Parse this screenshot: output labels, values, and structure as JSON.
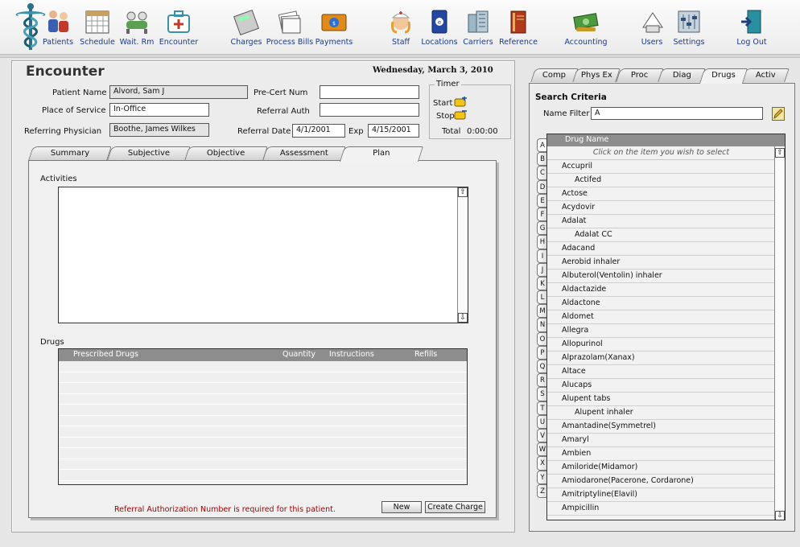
{
  "toolbar": {
    "items": [
      {
        "label": "Patients",
        "icon": "patients-icon"
      },
      {
        "label": "Schedule",
        "icon": "schedule-icon"
      },
      {
        "label": "Wait. Rm",
        "icon": "waiting-room-icon"
      },
      {
        "label": "Encounter",
        "icon": "encounter-icon"
      },
      {
        "label": "Charges",
        "icon": "calculator-icon"
      },
      {
        "label": "Process Bills",
        "icon": "bills-icon"
      },
      {
        "label": "Payments",
        "icon": "payment-card-icon"
      },
      {
        "label": "Staff",
        "icon": "nurse-icon"
      },
      {
        "label": "Locations",
        "icon": "locations-icon"
      },
      {
        "label": "Carriers",
        "icon": "carriers-icon"
      },
      {
        "label": "Reference",
        "icon": "reference-book-icon"
      },
      {
        "label": "Accounting",
        "icon": "money-icon"
      },
      {
        "label": "Users",
        "icon": "users-icon"
      },
      {
        "label": "Settings",
        "icon": "settings-icon"
      },
      {
        "label": "Log Out",
        "icon": "logout-door-icon"
      }
    ]
  },
  "encounter": {
    "title": "Encounter",
    "date": "Wednesday, March 3, 2010",
    "patient_name_label": "Patient Name",
    "patient_name": "Alvord, Sam J",
    "place_label": "Place of Service",
    "place": "In-Office",
    "referring_label": "Referring Physician",
    "referring": "Boothe, James Wilkes",
    "precert_label": "Pre-Cert Num",
    "precert": "",
    "referral_auth_label": "Referral Auth",
    "referral_auth": "",
    "referral_date_label": "Referral Date",
    "referral_date": "4/1/2001",
    "exp_label": "Exp",
    "exp": "4/15/2001",
    "timer": {
      "title": "Timer",
      "start_label": "Start",
      "stop_label": "Stop",
      "total_label": "Total",
      "total": "0:00:00"
    },
    "tabs": [
      "Summary",
      "Subjective",
      "Objective",
      "Assessment",
      "Plan"
    ],
    "active_tab": "Plan",
    "activities_label": "Activities",
    "drugs_label": "Drugs",
    "drug_columns": [
      "Prescribed Drugs",
      "Quantity",
      "Instructions",
      "Refills"
    ],
    "notice": "Referral Authorization Number is required for this patient.",
    "new_button": "New",
    "create_charge_button": "Create Charge"
  },
  "right": {
    "tabs": [
      "Comp",
      "Phys Ex",
      "Proc",
      "Diag",
      "Drugs",
      "Activ"
    ],
    "active_tab": "Drugs",
    "search_title": "Search Criteria",
    "name_filter_label": "Name Filter",
    "name_filter": "A",
    "letters": [
      "A",
      "B",
      "C",
      "D",
      "E",
      "F",
      "G",
      "H",
      "I",
      "J",
      "K",
      "L",
      "M",
      "N",
      "O",
      "P",
      "Q",
      "R",
      "S",
      "T",
      "U",
      "V",
      "W",
      "X",
      "Y",
      "Z"
    ],
    "active_letter": "A",
    "list_header": "Drug Name",
    "list_hint": "Click on the item you wish to select",
    "drugs": [
      {
        "name": "Accupril",
        "sub": false
      },
      {
        "name": "Actifed",
        "sub": true
      },
      {
        "name": "Actose",
        "sub": false
      },
      {
        "name": "Acydovir",
        "sub": false
      },
      {
        "name": "Adalat",
        "sub": false
      },
      {
        "name": "Adalat CC",
        "sub": true
      },
      {
        "name": "Adacand",
        "sub": false
      },
      {
        "name": "Aerobid inhaler",
        "sub": false
      },
      {
        "name": "Albuterol(Ventolin) inhaler",
        "sub": false
      },
      {
        "name": "Aldactazide",
        "sub": false
      },
      {
        "name": "Aldactone",
        "sub": false
      },
      {
        "name": "Aldomet",
        "sub": false
      },
      {
        "name": "Allegra",
        "sub": false
      },
      {
        "name": "Allopurinol",
        "sub": false
      },
      {
        "name": "Alprazolam(Xanax)",
        "sub": false
      },
      {
        "name": "Altace",
        "sub": false
      },
      {
        "name": "Alucaps",
        "sub": false
      },
      {
        "name": "Alupent tabs",
        "sub": false
      },
      {
        "name": "Alupent inhaler",
        "sub": true
      },
      {
        "name": "Amantadine(Symmetrel)",
        "sub": false
      },
      {
        "name": "Amaryl",
        "sub": false
      },
      {
        "name": "Ambien",
        "sub": false
      },
      {
        "name": "Amiloride(Midamor)",
        "sub": false
      },
      {
        "name": "Amiodarone(Pacerone, Cordarone)",
        "sub": false
      },
      {
        "name": "Amitriptyline(Elavil)",
        "sub": false
      },
      {
        "name": "Ampicillin",
        "sub": false
      }
    ]
  }
}
